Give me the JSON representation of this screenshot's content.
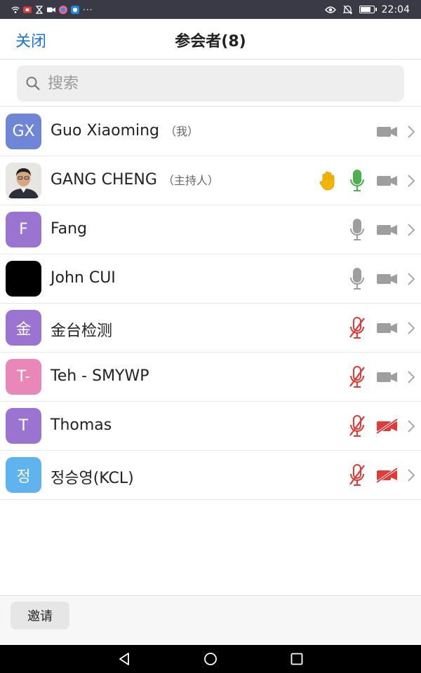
{
  "status_bar": {
    "time": "22:04",
    "left_icons": [
      "wifi-icon",
      "notification-icon",
      "hourglass-icon",
      "video-call-icon",
      "app-icon",
      "shield-icon"
    ],
    "more": "···",
    "right_icons": [
      "eye-icon",
      "mute-bell-icon",
      "battery-icon"
    ],
    "battery_level": 0.85
  },
  "header": {
    "close_label": "关闭",
    "title": "参会者(8)"
  },
  "search": {
    "placeholder": "搜索"
  },
  "participants": [
    {
      "initials": "GX",
      "name": "Guo Xiaoming",
      "tag": "（我）",
      "avatar_color": "#6f86d6",
      "avatar_type": "initials",
      "hand": false,
      "mic": "none",
      "video": "on"
    },
    {
      "initials": "",
      "name": "GANG CHENG",
      "tag": "（主持人）",
      "avatar_color": "#cfcfcf",
      "avatar_type": "photo",
      "hand": true,
      "mic": "active",
      "video": "on"
    },
    {
      "initials": "F",
      "name": "Fang",
      "tag": "",
      "avatar_color": "#9a74d0",
      "avatar_type": "initials",
      "hand": false,
      "mic": "on",
      "video": "on"
    },
    {
      "initials": "",
      "name": "John CUI",
      "tag": "",
      "avatar_color": "#000000",
      "avatar_type": "solid",
      "hand": false,
      "mic": "on",
      "video": "on"
    },
    {
      "initials": "金",
      "name": "金台检测",
      "tag": "",
      "avatar_color": "#9a74d0",
      "avatar_type": "initials",
      "hand": false,
      "mic": "muted",
      "video": "on"
    },
    {
      "initials": "T-",
      "name": "Teh - SMYWP",
      "tag": "",
      "avatar_color": "#e887b8",
      "avatar_type": "initials",
      "hand": false,
      "mic": "muted",
      "video": "on"
    },
    {
      "initials": "T",
      "name": "Thomas",
      "tag": "",
      "avatar_color": "#9a74d0",
      "avatar_type": "initials",
      "hand": false,
      "mic": "muted",
      "video": "off"
    },
    {
      "initials": "정",
      "name": "정승영(KCL)",
      "tag": "",
      "avatar_color": "#5fb3ee",
      "avatar_type": "initials",
      "hand": false,
      "mic": "muted",
      "video": "off"
    }
  ],
  "footer": {
    "invite_label": "邀请"
  },
  "colors": {
    "accent": "#1a73d9",
    "muted_red": "#e53935",
    "active_green": "#4caf50",
    "icon_gray": "#9e9e9e",
    "hand_yellow": "#f5b400"
  }
}
